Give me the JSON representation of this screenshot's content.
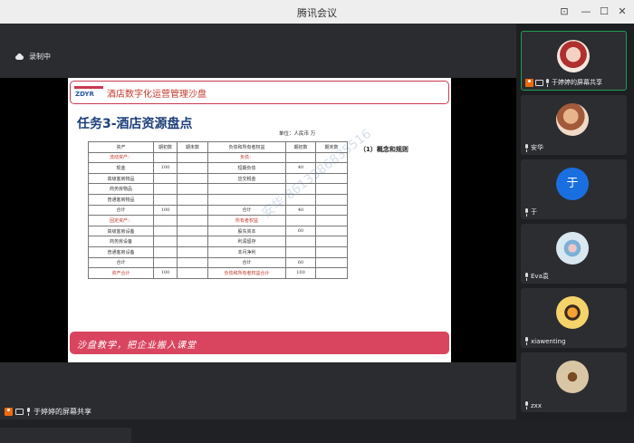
{
  "window": {
    "title": "腾讯会议"
  },
  "recording": {
    "label": "录制中"
  },
  "slide": {
    "logo_text": "ZDYR",
    "header_title": "酒店数字化运营管理沙盘",
    "task_title": "任务3-酒店资源盘点",
    "unit": "单位：人民币  万",
    "concept": "（1）概念和规则",
    "table": {
      "headers": [
        "资产",
        "期初数",
        "期末数",
        "负债和所有者权益",
        "期初数",
        "期末数"
      ],
      "rows": [
        [
          "流动资产：",
          "",
          "",
          "负债：",
          "",
          ""
        ],
        [
          "现金",
          "100",
          "",
          "短期负债",
          "40",
          ""
        ],
        [
          "高级客房物品",
          "",
          "",
          "应交税金",
          "",
          ""
        ],
        [
          "商务房物品",
          "",
          "",
          "",
          "",
          ""
        ],
        [
          "普通客房物品",
          "",
          "",
          "",
          "",
          ""
        ],
        [
          "合计",
          "100",
          "",
          "合计",
          "40",
          ""
        ],
        [
          "固定资产：",
          "",
          "",
          "所有者权益",
          "",
          ""
        ],
        [
          "高级客房设备",
          "",
          "",
          "股东资本",
          "60",
          ""
        ],
        [
          "商务房设备",
          "",
          "",
          "利润留存",
          "",
          ""
        ],
        [
          "普通客房设备",
          "",
          "",
          "本月净利",
          "",
          ""
        ],
        [
          "合计",
          "",
          "",
          "合计",
          "60",
          ""
        ],
        [
          "资产合计",
          "100",
          "",
          "负债和所有者权益合计",
          "100",
          ""
        ]
      ]
    },
    "watermark": "安华 8613386835516",
    "footer": "沙盘教学，把企业搬入课堂"
  },
  "shared_screen_label": "于婷婷的屏幕共享",
  "participants": [
    {
      "name": "于婷婷的屏幕共享",
      "type": "photo",
      "active": true
    },
    {
      "name": "安华",
      "type": "photo",
      "active": false
    },
    {
      "name": "于",
      "type": "letter",
      "letter": "于",
      "active": false
    },
    {
      "name": "Eva袁",
      "type": "photo",
      "active": false
    },
    {
      "name": "xiawenting",
      "type": "photo",
      "active": false
    },
    {
      "name": "zxx",
      "type": "photo",
      "active": false
    }
  ],
  "colors": {
    "accent_red": "#c83a52",
    "title_blue": "#1d3f7a",
    "active_border": "#1f9d55",
    "avatar_blue": "#1a6fe0"
  }
}
